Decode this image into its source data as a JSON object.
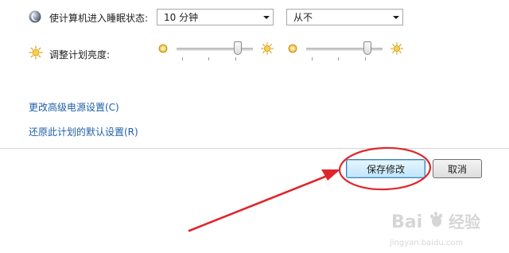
{
  "sleep": {
    "label": "使计算机进入睡眠状态:",
    "on_battery_value": "10 分钟",
    "plugged_in_value": "从不"
  },
  "brightness": {
    "label": "调整计划亮度:",
    "on_battery_level_pct": 80,
    "plugged_in_level_pct": 80
  },
  "links": {
    "advanced": "更改高级电源设置(C)",
    "restore": "还原此计划的默认设置(R)"
  },
  "buttons": {
    "save": "保存修改",
    "cancel": "取消"
  },
  "annotation": {
    "color": "#e0252a"
  },
  "watermark": {
    "brand": "Baidu经验",
    "domain": "jingyan.baidu.com"
  }
}
